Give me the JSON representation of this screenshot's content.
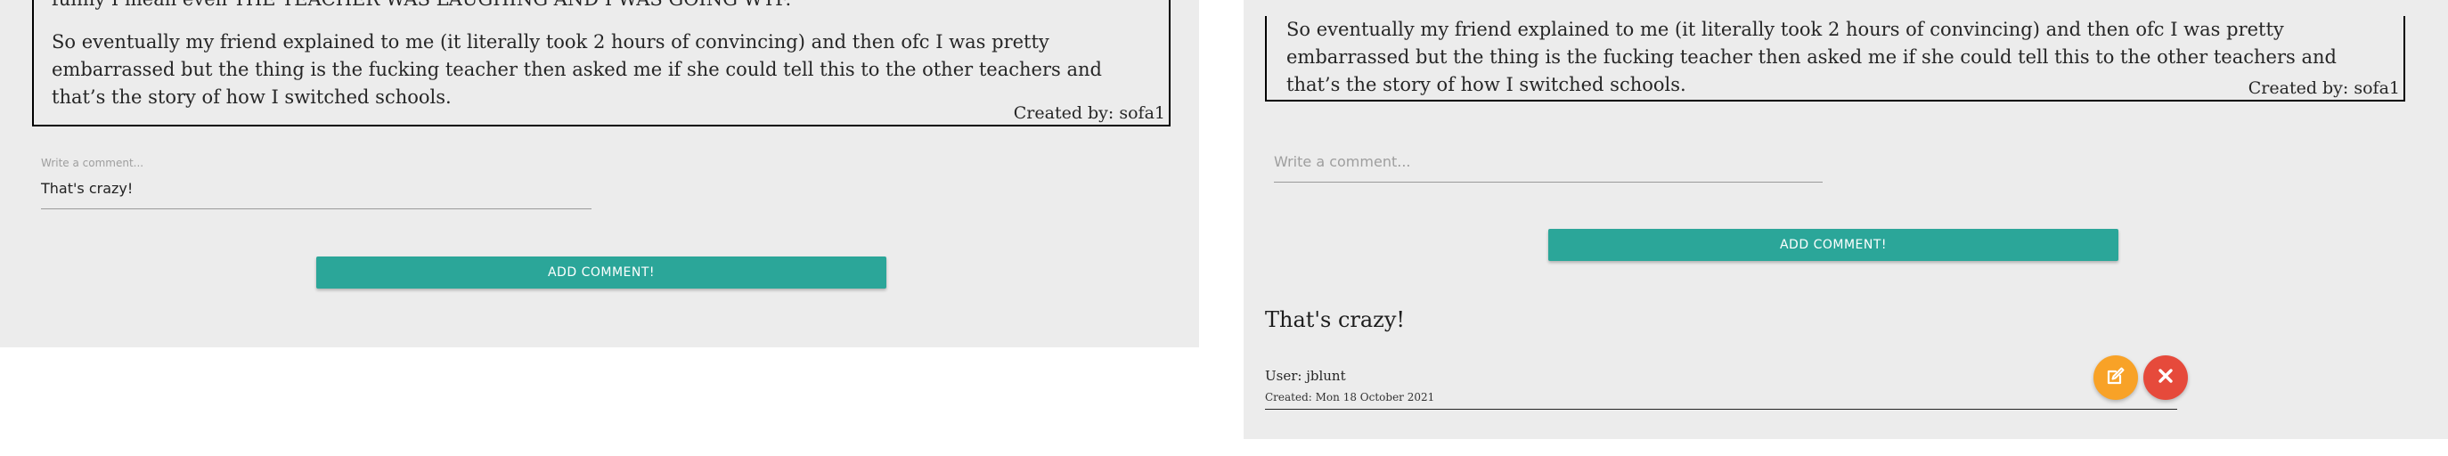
{
  "left_panel": {
    "story_line1": "funny I mean even THE TEACHER WAS LAUGHING AND I WAS GOING WTF.",
    "story_para2": "So eventually my friend explained to me (it literally took 2 hours of convincing) and then ofc I was pretty embarrassed but the thing is the fucking teacher then asked me if she could tell this to the other teachers and that’s the story of how I switched schools.",
    "created_by": "Created by: sofa1",
    "comment_label": "Write a comment...",
    "comment_value": "That's crazy!",
    "add_comment_label": "ADD COMMENT!"
  },
  "right_panel": {
    "story_para2": "So eventually my friend explained to me (it literally took 2 hours of convincing) and then ofc I was pretty embarrassed but the thing is the fucking teacher then asked me if she could tell this to the other teachers and that’s the story of how I switched schools.",
    "created_by": "Created by: sofa1",
    "comment_placeholder": "Write a comment...",
    "add_comment_label": "ADD COMMENT!",
    "comment": {
      "text": "That's crazy!",
      "user": "User: jblunt",
      "created": "Created: Mon 18 October 2021"
    },
    "edit_icon": "edit-icon",
    "delete_icon": "close-icon"
  },
  "colors": {
    "panel_bg": "#ececec",
    "button_teal": "#2ba699",
    "edit_orange": "#f8a227",
    "delete_red": "#e64a3b"
  }
}
